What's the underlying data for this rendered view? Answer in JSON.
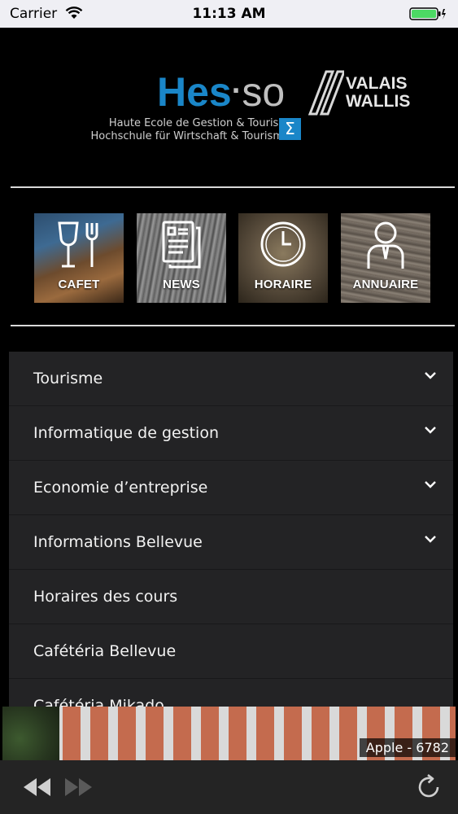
{
  "status_bar": {
    "carrier": "Carrier",
    "time": "11:13 AM",
    "battery_color": "#4cd964"
  },
  "logo": {
    "wordmark_left": "Hes",
    "wordmark_right": "so",
    "region_line1": "VALAIS",
    "region_line2": "WALLIS",
    "subtitle_fr": "Haute Ecole de Gestion & Tourisme",
    "subtitle_de": "Hochschule für Wirtschaft & Tourismus",
    "sigma": "Σ",
    "brand_color": "#1a86c8"
  },
  "tiles": [
    {
      "label": "CAFET",
      "icon": "glass-fork-icon"
    },
    {
      "label": "NEWS",
      "icon": "newspaper-icon"
    },
    {
      "label": "HORAIRE",
      "icon": "clock-icon"
    },
    {
      "label": "ANNUAIRE",
      "icon": "person-icon"
    }
  ],
  "menu": [
    {
      "label": "Tourisme",
      "expandable": true
    },
    {
      "label": "Informatique de gestion",
      "expandable": true
    },
    {
      "label": "Economie d’entreprise",
      "expandable": true
    },
    {
      "label": "Informations Bellevue",
      "expandable": true
    },
    {
      "label": "Horaires des cours",
      "expandable": false
    },
    {
      "label": "Cafétéria Bellevue",
      "expandable": false
    },
    {
      "label": "Cafétéria Mikado",
      "expandable": false
    }
  ],
  "photo_credit": "Apple - 6782",
  "toolbar": {
    "back": "rewind-icon",
    "forward": "fast-forward-icon",
    "reload": "reload-icon"
  }
}
